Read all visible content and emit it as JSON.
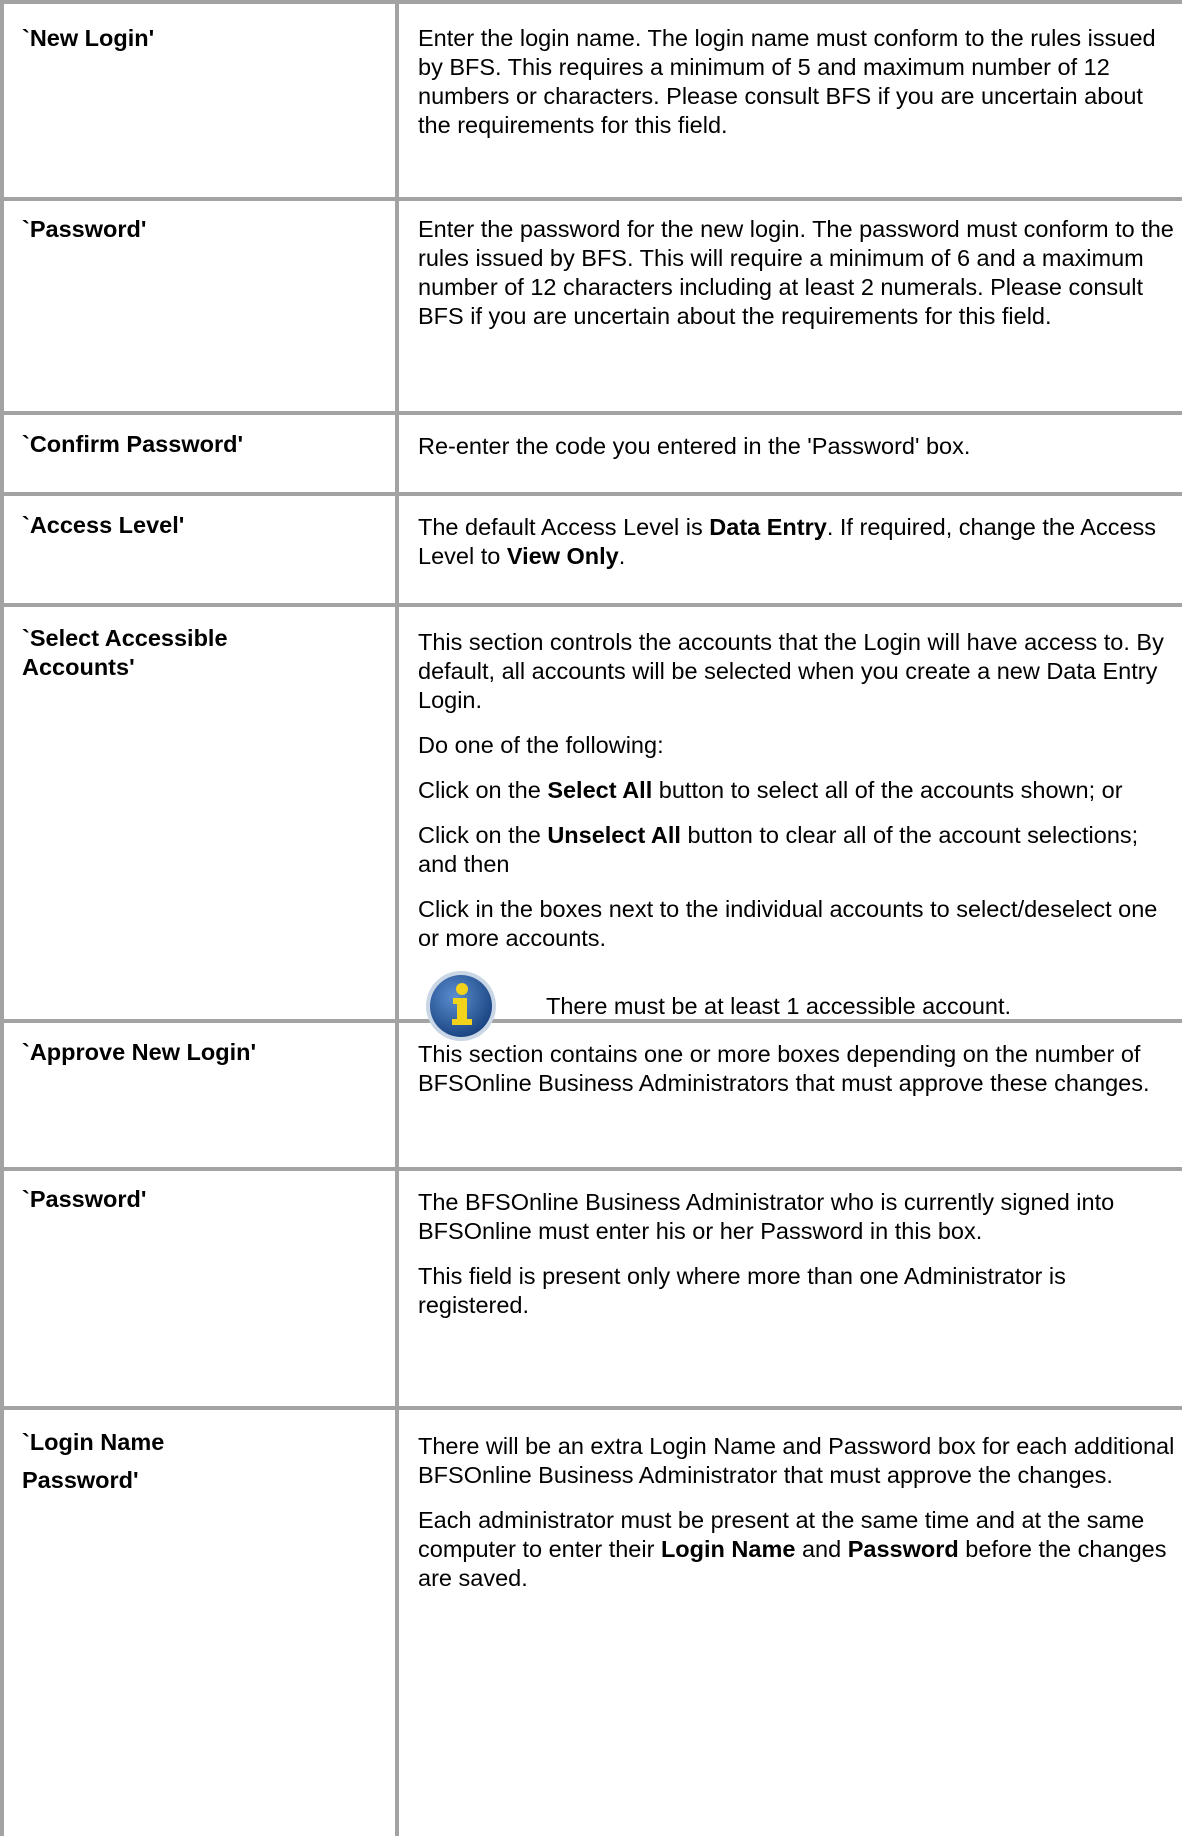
{
  "rows": [
    {
      "label": "`New Login'",
      "paragraphs": [
        [
          "Enter the login name. The login name must conform to the rules issued by BFS. This requires a minimum of 5 and maximum number of 12 numbers or characters. Please consult BFS if you are uncertain about the requirements for this field."
        ]
      ]
    },
    {
      "label": "`Password'",
      "paragraphs": [
        [
          "Enter the password for the new login. The password must conform to the rules issued by BFS. This will require a minimum of 6 and a maximum number of 12 characters including at least 2 numerals. Please consult BFS if you are uncertain about the requirements for this field."
        ]
      ]
    },
    {
      "label": "`Confirm Password'",
      "paragraphs": [
        [
          "Re-enter the code you entered in the 'Password' box."
        ]
      ]
    },
    {
      "label": "`Access Level'",
      "paragraphs": [
        [
          "The default Access Level is ",
          "Data Entry",
          ". If required, change the Access Level to ",
          "View Only",
          "."
        ]
      ]
    },
    {
      "label": "`Select Accessible Accounts'",
      "paragraphs": [
        [
          "This section controls the accounts that the Login will have access to. By default, all accounts will be selected when you create a new Data Entry Login."
        ],
        [
          "Do one of the following:"
        ],
        [
          "Click on the ",
          "Select All",
          " button to select all of the accounts shown; or"
        ],
        [
          "Click on the ",
          "Unselect All",
          " button to clear all of the account selections; and then"
        ],
        [
          "Click in the boxes next to the individual accounts to select/deselect one or more accounts."
        ]
      ],
      "note": "There must be at least 1 accessible account.",
      "note_icon": "info-icon"
    },
    {
      "label": "`Approve New Login'",
      "paragraphs": [
        [
          "This section contains one or more boxes depending on the number of BFSOnline Business Administrators that must approve these changes."
        ]
      ]
    },
    {
      "label": "`Password'",
      "paragraphs": [
        [
          "The BFSOnline Business Administrator who is currently signed into BFSOnline must enter his or her Password in this box."
        ],
        [
          "This field is present only where more than one Administrator is registered."
        ]
      ]
    },
    {
      "label_lines": [
        "`Login Name",
        "Password'"
      ],
      "paragraphs": [
        [
          "There will be an extra Login Name and Password box for each additional BFSOnline Business Administrator that must approve the changes."
        ],
        [
          "Each administrator must be present at the same time and at the same computer to enter their ",
          "Login Name",
          " and ",
          "Password",
          " before the changes are saved."
        ]
      ]
    }
  ],
  "colors": {
    "grid": "#a3a3a3",
    "icon_blue": "#1f5fa8",
    "icon_yellow": "#f2d21b"
  }
}
